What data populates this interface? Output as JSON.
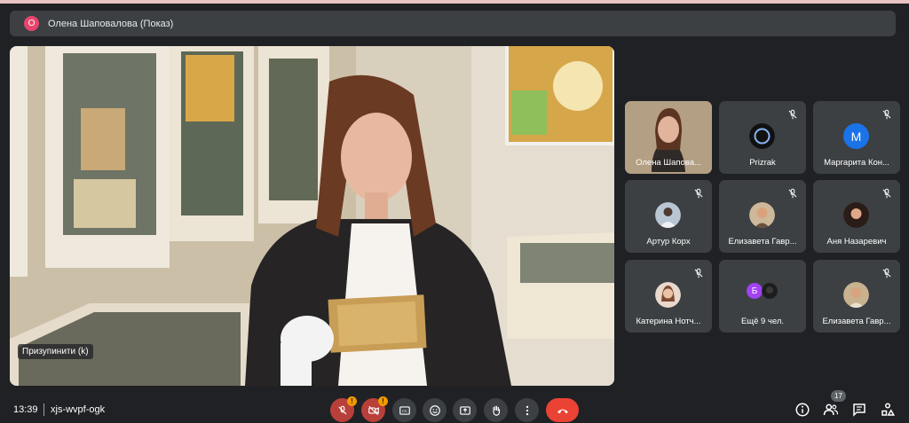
{
  "presenter_banner": {
    "avatar_letter": "О",
    "title": "Олена Шаповалова (Показ)"
  },
  "main_video": {
    "pin_label": "Призупинити (k)"
  },
  "participants": [
    {
      "name": "Олена Шапова...",
      "muted": false,
      "avatar": "video"
    },
    {
      "name": "Prizrak",
      "muted": true,
      "avatar": "photo"
    },
    {
      "name": "Маргарита Кон...",
      "muted": true,
      "avatar": "letter",
      "letter": "М"
    },
    {
      "name": "Артур Корх",
      "muted": true,
      "avatar": "photo"
    },
    {
      "name": "Елизавета Гавр...",
      "muted": true,
      "avatar": "photo"
    },
    {
      "name": "Аня Назаревич",
      "muted": true,
      "avatar": "photo"
    },
    {
      "name": "Катерина Нотч...",
      "muted": true,
      "avatar": "photo"
    },
    {
      "name": "Ещё 9 чел.",
      "muted": false,
      "avatar": "more",
      "letter": "Б"
    },
    {
      "name": "Елизавета Гавр...",
      "muted": true,
      "avatar": "photo"
    }
  ],
  "bottom_bar": {
    "time": "13:39",
    "meeting_code": "xjs-wvpf-ogk",
    "warning_mark": "!",
    "people_count": "17"
  },
  "colors": {
    "background": "#202124",
    "tile": "#3c4043",
    "danger": "#ea4335",
    "warning": "#f29900",
    "accent": "#1a73e8"
  }
}
